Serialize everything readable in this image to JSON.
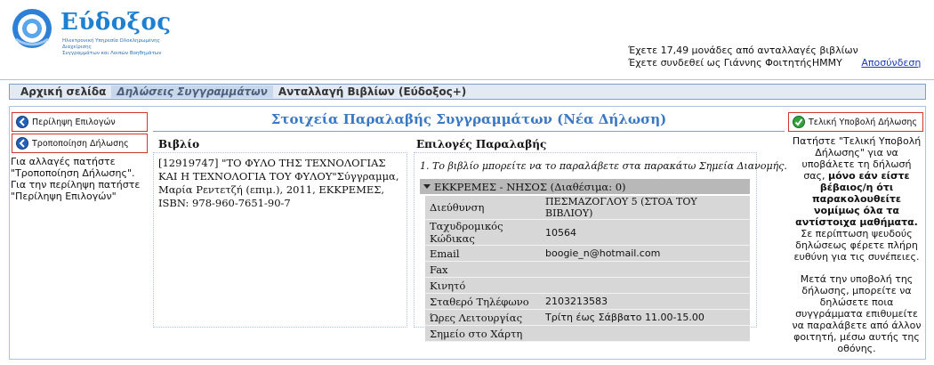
{
  "brand": {
    "name": "Εύδοξος",
    "tagline": "Ηλεκτρονική Υπηρεσία Ολοκληρωμένης Διαχείρισης\nΣυγγραμμάτων και Λοιπών Βοηθημάτων"
  },
  "account": {
    "credits": "Έχετε 17,49 μονάδες από ανταλλαγές βιβλίων",
    "logged_in": "Έχετε συνδεθεί ως Γιάννης ΦοιτητήςΗΜΜΥ",
    "logout": "Αποσύνδεση"
  },
  "nav": {
    "items": [
      {
        "label": "Αρχική σελίδα",
        "active": false
      },
      {
        "label": "Δηλώσεις Συγγραμμάτων",
        "active": true
      },
      {
        "label": "Ανταλλαγή Βιβλίων (Εύδοξος+)",
        "active": false
      }
    ]
  },
  "left": {
    "summary_button": "Περίληψη Επιλογών",
    "edit_button": "Τροποποίηση Δήλωσης",
    "note": "Για αλλαγές πατήστε \"Τροποποίηση Δήλωσης\". Για την περίληψη πατήστε \"Περίληψη Επιλογών\""
  },
  "main": {
    "title": "Στοιχεία Παραλαβής Συγγραμμάτων (Νέα Δήλωση)",
    "book_col": "Βιβλίο",
    "options_col": "Επιλογές Παραλαβής",
    "book_text": "[12919747] \"ΤΟ ΦΥΛΟ ΤΗΣ ΤΕΧΝΟΛΟΓΙΑΣ ΚΑΙ Η ΤΕΧΝΟΛΟΓΙΑ ΤΟΥ ΦΥΛΟΥ\"Σύγγραμμα, Μαρία Ρεντετζή (επιμ.), 2011, ΕΚΚΡΕΜΕΣ, ISBN: 978-960-7651-90-7",
    "options_note": "1. Το βιβλίο μπορείτε να το παραλάβετε στα παρακάτω Σημεία Διανομής.",
    "pickup_header": "ΕΚΚΡΕΜΕΣ - ΝΗΣΟΣ (Διαθέσιμα: 0)",
    "details": [
      {
        "label": "Διεύθυνση",
        "value": "ΠΕΣΜΑΖΟΓΛΟΥ 5 (ΣΤΟΑ ΤΟΥ ΒΙΒΛΙΟΥ)"
      },
      {
        "label": "Ταχυδρομικός Κώδικας",
        "value": "10564"
      },
      {
        "label": "Email",
        "value": "boogie_n@hotmail.com"
      },
      {
        "label": "Fax",
        "value": ""
      },
      {
        "label": "Κινητό",
        "value": ""
      },
      {
        "label": "Σταθερό Τηλέφωνο",
        "value": "2103213583"
      },
      {
        "label": "Ώρες Λειτουργίας",
        "value": "Τρίτη έως Σάββατο 11.00-15.00"
      },
      {
        "label": "Σημείο στο Χάρτη",
        "value": ""
      }
    ]
  },
  "right": {
    "submit_button": "Τελική Υποβολή Δήλωσης",
    "text1a": "Πατήστε \"Τελική Υποβολή Δήλωσης\" για να υποβάλετε τη δήλωσή σας,",
    "text1b": "μόνο εάν είστε βέβαιος/η ότι παρακολουθείτε νομίμως όλα τα αντίστοιχα μαθήματα.",
    "text1c": "Σε περίπτωση ψευδούς δηλώσεως φέρετε πλήρη ευθύνη για τις συνέπειες.",
    "text2": "Μετά την υποβολή της δήλωσης, μπορείτε να δηλώσετε ποια συγγράμματα επιθυμείτε να παραλάβετε από άλλον φοιτητή, μέσω αυτής της οθόνης."
  },
  "colors": {
    "accent_blue": "#3b78c4",
    "button_border": "#c73a2a",
    "icon_blue": "#2360b8",
    "icon_green": "#2fa43a"
  }
}
